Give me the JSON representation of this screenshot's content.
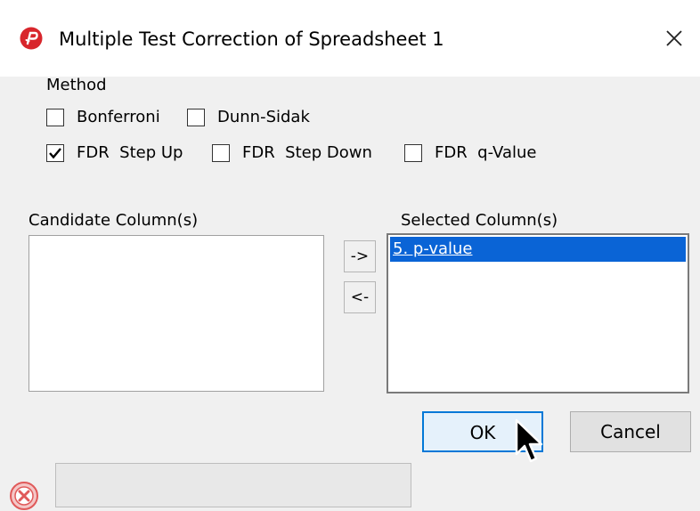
{
  "window": {
    "title": "Multiple Test Correction of Spreadsheet 1",
    "app_icon": "partek-logo-icon",
    "close_icon": "close-icon"
  },
  "method": {
    "label": "Method",
    "options": [
      {
        "label": "Bonferroni",
        "checked": false
      },
      {
        "label": "Dunn-Sidak",
        "checked": false
      },
      {
        "label": "FDR  Step Up",
        "checked": true
      },
      {
        "label": "FDR  Step Down",
        "checked": false
      },
      {
        "label": "FDR  q-Value",
        "checked": false
      }
    ]
  },
  "candidate": {
    "label": "Candidate Column(s)",
    "items": []
  },
  "transfer": {
    "add_label": "->",
    "remove_label": "<-"
  },
  "selected": {
    "label": "Selected Column(s)",
    "items": [
      "5. p-value"
    ]
  },
  "buttons": {
    "ok_label": "OK",
    "cancel_label": "Cancel"
  },
  "status": {
    "icon": "error-icon",
    "text": ""
  },
  "colors": {
    "accent": "#0078d7",
    "selection": "#0a64d6",
    "logo_red": "#d8262c"
  }
}
